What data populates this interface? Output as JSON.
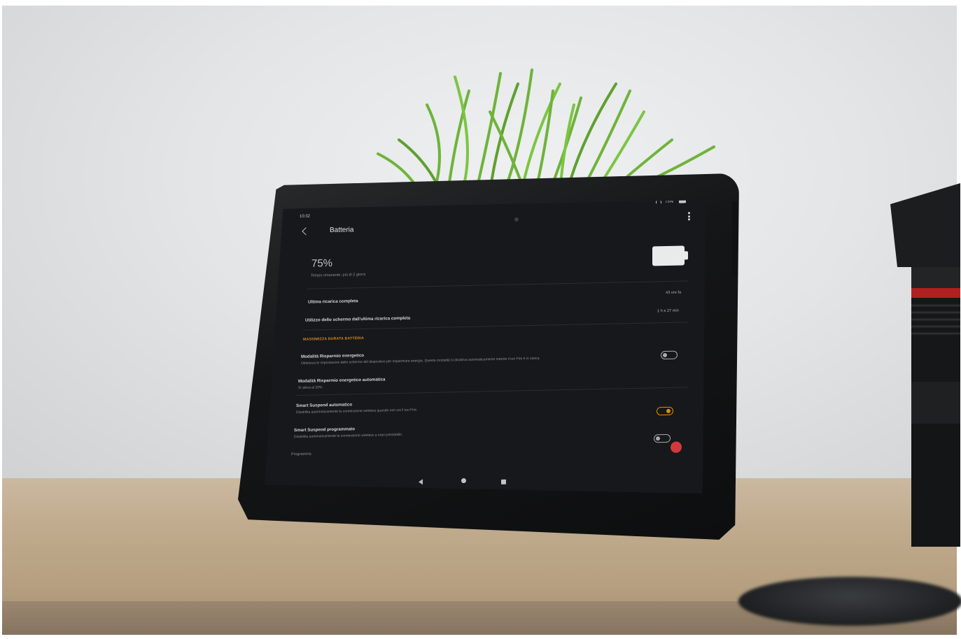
{
  "scene": {
    "description_colors": {
      "wall": "#e3e5e6",
      "desk": "#c0ab8e",
      "tablet_bezel": "#151617",
      "screen_bg": "#17181b",
      "accent": "#e58a14"
    }
  },
  "tablet": {
    "status_bar": {
      "time": "10:32",
      "battery": "75%",
      "icons": [
        "wifi-icon",
        "battery-icon"
      ]
    },
    "header": {
      "title": "Batteria",
      "back_icon": "chevron-left-icon",
      "menu_icon": "more-vertical-icon"
    },
    "battery_summary": {
      "percent": "75%",
      "remaining": "Tempo rimanente: più di 2 giorni"
    },
    "usage": [
      {
        "label": "Ultima ricarica completa",
        "value": "43 ore fa"
      },
      {
        "label": "Utilizzo dello schermo dall'ultima ricarica completa",
        "value": "1 h e 27 min"
      }
    ],
    "section_title": "MASSIMIZZA DURATA BATTERIA",
    "settings": [
      {
        "title": "Modalità Risparmio energetico",
        "subtitle": "Ottimizza le impostazioni dello schermo del dispositivo per risparmiare energia. Questa modalità si disattiva automaticamente mentre il tuo Fire è in carica.",
        "toggle": "off"
      },
      {
        "title": "Modalità Risparmio energetico automatica",
        "subtitle": "Si attiva al 20%",
        "toggle": null
      },
      {
        "title": "Smart Suspend automatico",
        "subtitle": "Disabilita automaticamente la connessione wireless quando non usi il tuo Fire.",
        "toggle": "on"
      },
      {
        "title": "Smart Suspend programmato",
        "subtitle": "Disabilita automaticamente la connessione wireless a orari prestabiliti.",
        "toggle": "off"
      }
    ],
    "footer_partial": "Programma",
    "nav_bar": [
      "nav-back-icon",
      "nav-home-icon",
      "nav-recents-icon"
    ]
  }
}
